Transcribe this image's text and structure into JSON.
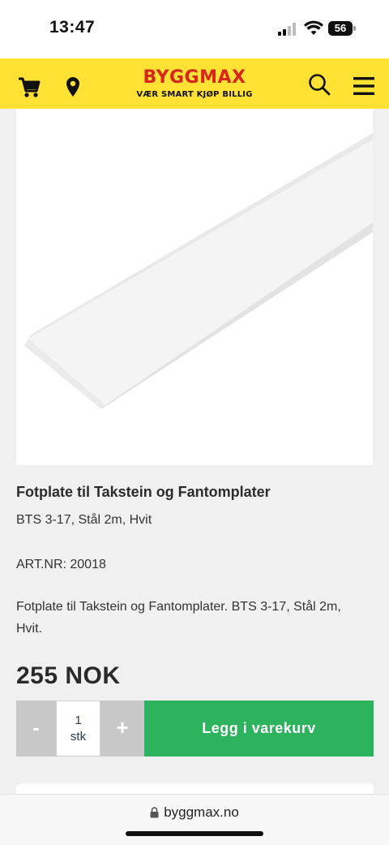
{
  "status_bar": {
    "time": "13:47",
    "battery": "56",
    "icons": [
      "signal-icon",
      "wifi-icon",
      "battery-icon"
    ]
  },
  "header": {
    "logo": "BYGGMAX",
    "tagline": "VÆR SMART KJØP BILLIG",
    "icons": [
      "cart-icon",
      "location-pin-icon",
      "search-icon",
      "menu-icon"
    ],
    "colors": {
      "background": "#ffe233",
      "logo": "#d9261c"
    }
  },
  "product": {
    "title": "Fotplate til Takstein og Fantomplater",
    "subtitle": "BTS 3-17, Stål 2m, Hvit",
    "art_nr": "ART.NR: 20018",
    "description": "Fotplate til Takstein og Fantomplater. BTS 3-17, Stål 2m, Hvit.",
    "price": "255 NOK"
  },
  "purchase": {
    "minus_label": "-",
    "quantity": "1",
    "unit": "stk",
    "plus_label": "+",
    "add_to_cart_label": "Legg i varekurv",
    "colors": {
      "add_to_cart": "#2db35d",
      "stepper": "#c8c8c8"
    }
  },
  "browser": {
    "url": "byggmax.no",
    "icons": [
      "lock-icon"
    ]
  }
}
